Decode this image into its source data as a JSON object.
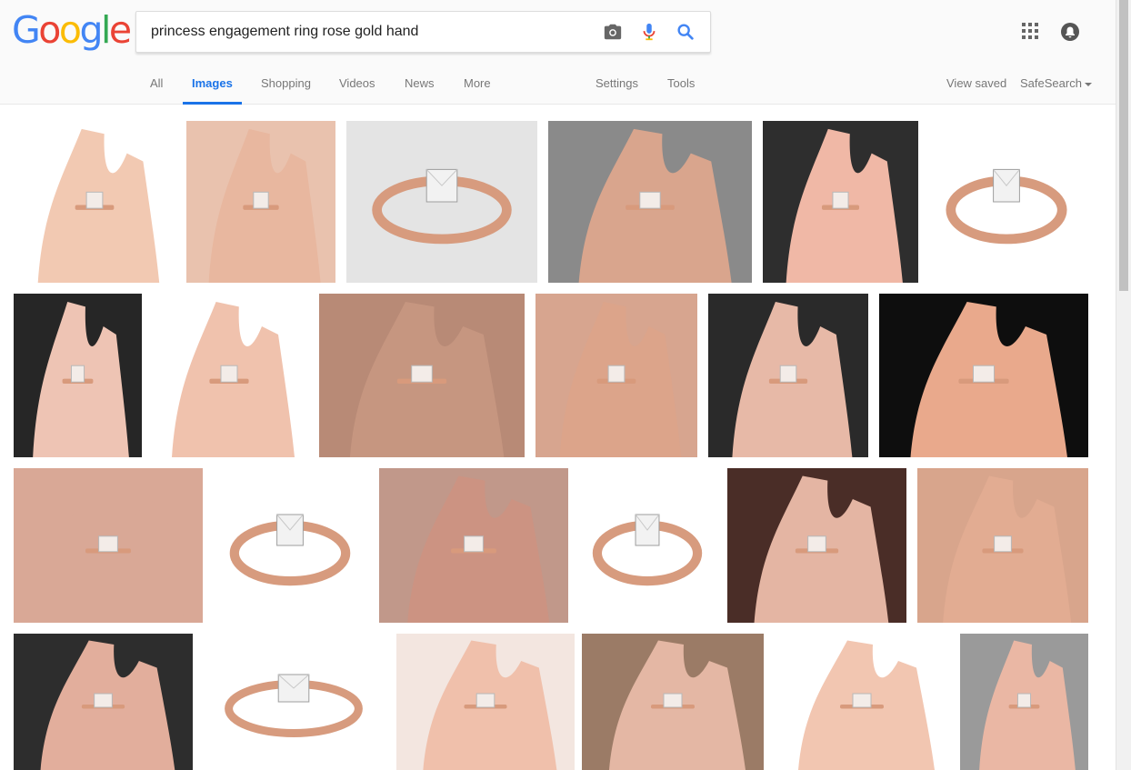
{
  "logo": {
    "letters": [
      "G",
      "o",
      "o",
      "g",
      "l",
      "e"
    ],
    "colors": [
      "#4285F4",
      "#EA4335",
      "#FBBC05",
      "#4285F4",
      "#34A853",
      "#EA4335"
    ]
  },
  "search": {
    "query": "princess engagement ring rose gold hand",
    "placeholder": "",
    "icons": [
      "camera-icon",
      "microphone-icon",
      "search-icon"
    ]
  },
  "tabs": [
    {
      "label": "All",
      "active": false
    },
    {
      "label": "Images",
      "active": true
    },
    {
      "label": "Shopping",
      "active": false
    },
    {
      "label": "Videos",
      "active": false
    },
    {
      "label": "News",
      "active": false
    },
    {
      "label": "More",
      "active": false
    }
  ],
  "tools": {
    "settings": "Settings",
    "tools": "Tools"
  },
  "right_links": {
    "view_saved": "View saved",
    "safesearch": "SafeSearch"
  },
  "header_icons": [
    "apps-grid-icon",
    "notifications-bell-icon"
  ],
  "colors": {
    "accent": "#1a73e8",
    "text_muted": "#777777",
    "header_bg": "#fafafa"
  },
  "results": {
    "rows": [
      [
        {
          "kind": "hand-ring",
          "bg": "#ffffff",
          "skin": "#f2c9b2"
        },
        {
          "kind": "hand-ring",
          "bg": "#e9c2ae",
          "skin": "#e8b79f"
        },
        {
          "kind": "ring-product",
          "bg": "#e4e4e4",
          "skin": ""
        },
        {
          "kind": "hand-ring",
          "bg": "#8a8a8a",
          "skin": "#d9a58d"
        },
        {
          "kind": "hand-ring",
          "bg": "#2e2e2e",
          "skin": "#f0b8a6"
        },
        {
          "kind": "ring-product",
          "bg": "#ffffff",
          "skin": ""
        }
      ],
      [
        {
          "kind": "hand-ring",
          "bg": "#262626",
          "skin": "#eec4b4"
        },
        {
          "kind": "hand-ring",
          "bg": "#ffffff",
          "skin": "#f0c2ad"
        },
        {
          "kind": "hand-ring",
          "bg": "#b88a76",
          "skin": "#c69680"
        },
        {
          "kind": "hand-ring",
          "bg": "#d7a58f",
          "skin": "#dca48a"
        },
        {
          "kind": "hand-ring",
          "bg": "#2a2a2a",
          "skin": "#e7b9a7"
        },
        {
          "kind": "hand-ring",
          "bg": "#0e0e0e",
          "skin": "#e9a98c"
        }
      ],
      [
        {
          "kind": "hand-ring",
          "bg": "#d9a896",
          "skin": "#d9a896"
        },
        {
          "kind": "ring-product",
          "bg": "#ffffff",
          "skin": ""
        },
        {
          "kind": "hand-ring",
          "bg": "#c1988a",
          "skin": "#cc9382"
        },
        {
          "kind": "ring-product",
          "bg": "#ffffff",
          "skin": ""
        },
        {
          "kind": "hand-ring",
          "bg": "#4a2d27",
          "skin": "#e4b5a3"
        },
        {
          "kind": "hand-ring",
          "bg": "#d8a58c",
          "skin": "#e2ac92"
        }
      ],
      [
        {
          "kind": "hand-ring",
          "bg": "#2d2d2d",
          "skin": "#e2ae9c"
        },
        {
          "kind": "ring-product",
          "bg": "#ffffff",
          "skin": ""
        },
        {
          "kind": "hand-ring",
          "bg": "#f3e6e0",
          "skin": "#f0c0ab"
        },
        {
          "kind": "hand-ring",
          "bg": "#9b7b66",
          "skin": "#e4b7a4"
        },
        {
          "kind": "hand-ring",
          "bg": "#ffffff",
          "skin": "#f2c6b1"
        },
        {
          "kind": "hand-ring",
          "bg": "#9a9a9a",
          "skin": "#eab7a4"
        }
      ]
    ]
  }
}
